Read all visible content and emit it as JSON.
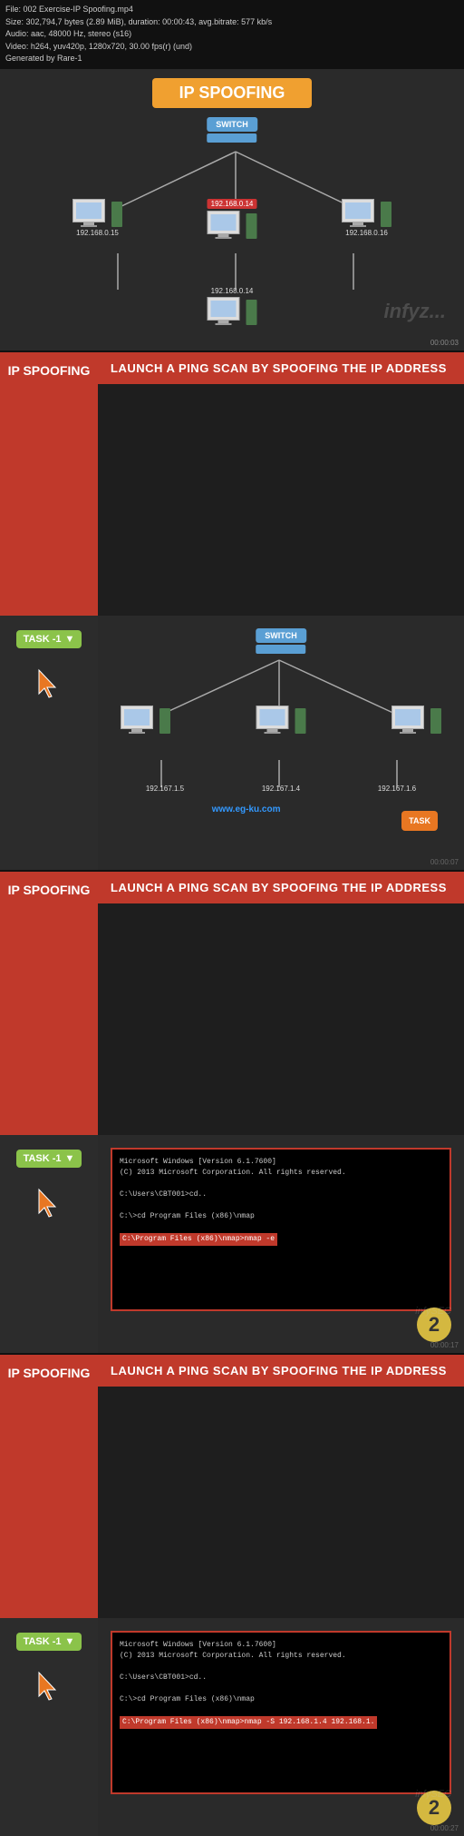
{
  "info_bar": {
    "line1": "File: 002 Exercise-IP Spoofing.mp4",
    "line2": "Size: 302,794,7 bytes (2.89 MiB), duration: 00:00:43, avg.bitrate: 577 kb/s",
    "line3": "Audio: aac, 48000 Hz, stereo (s16)",
    "line4": "Video: h264, yuv420p, 1280x720, 30.00 fps(r) (und)",
    "line5": "Generated by Rare-1"
  },
  "top_diagram": {
    "title": "IP SPOOFING",
    "switch_label": "SWITCH",
    "nodes": [
      {
        "ip": "192.168.0.15",
        "position": "left"
      },
      {
        "ip": "192.168.0.16",
        "position": "right"
      },
      {
        "ip": "192.168.0.14",
        "position": "center-red"
      },
      {
        "ip": "192.168.0.14",
        "position": "bottom"
      }
    ],
    "watermark": "infyz...",
    "timestamp": "00:00:03"
  },
  "section1": {
    "sidebar": {
      "label": "IP SPOOFING",
      "task_label": "TASK -1",
      "dropdown_arrow": "▼"
    },
    "header": "LAUNCH A PING SCAN BY SPOOFING THE IP ADDRESS",
    "diagram": {
      "switch_label": "SWITCH",
      "ips": [
        "192.167.1.5",
        "192.167.1.4",
        "192.167.1.6"
      ],
      "www_label": "www.eg-ku.com",
      "task_badge": "TASK"
    },
    "timestamp": "00:00:07"
  },
  "section2": {
    "sidebar": {
      "label": "IP SPOOFING",
      "task_label": "TASK -1",
      "dropdown_arrow": "▼"
    },
    "header": "LAUNCH A PING SCAN BY SPOOFING THE IP ADDRESS",
    "terminal": {
      "lines": [
        "Microsoft Windows [Version 6.1.7600]",
        "(C) 2013 Microsoft Corporation. All rights reserved.",
        "",
        "C:\\Users\\CBT001>cd..",
        "",
        "C:\\>cd Program Files (x86)\\nmap",
        "",
        "C:\\Program Files (x86)\\nmap>nmap -e",
        ""
      ],
      "highlight_line": "C:\\Program Files (x86)\\nmap>nmap -e"
    },
    "step_badge": "2",
    "watermark": "infySEC",
    "timestamp": "00:00:17"
  },
  "section3": {
    "sidebar": {
      "label": "IP SPOOFING",
      "task_label": "TASK -1",
      "dropdown_arrow": "▼"
    },
    "header": "LAUNCH A PING SCAN BY SPOOFING THE IP ADDRESS",
    "terminal": {
      "lines": [
        "Microsoft Windows [Version 6.1.7600]",
        "(C) 2013 Microsoft Corporation. All rights reserved.",
        "",
        "C:\\Users\\CBT001>cd..",
        "",
        "C:\\>cd Program Files (x86)\\nmap",
        "",
        "C:\\Program Files (x86)\\nmap>nmap -S 192.168.1.4 192.168.1.",
        ""
      ],
      "highlight_line": "C:\\Program Files (x86)\\nmap>nmap -S 192.168.1.4 192.168.1."
    },
    "step_badge": "2",
    "watermark": "infySEC",
    "timestamp": "00:00:27"
  },
  "colors": {
    "red": "#c0392b",
    "green": "#8bc34a",
    "orange": "#e87722",
    "gold": "#d4b840",
    "blue": "#5a9fd4",
    "title_orange": "#f0a030"
  }
}
